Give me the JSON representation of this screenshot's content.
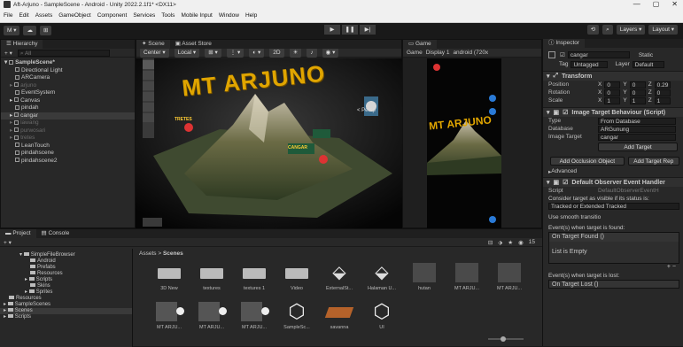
{
  "window": {
    "title": "Aft-Arjuno - SampleScene - Android - Unity 2022.2.1f1* <DX11>",
    "controls": [
      "—",
      "▢",
      "✕"
    ]
  },
  "menu": [
    "File",
    "Edit",
    "Assets",
    "GameObject",
    "Component",
    "Services",
    "Tools",
    "Mobile Input",
    "Window",
    "Help"
  ],
  "toolbar": {
    "account": "M ▾",
    "layers": "Layers",
    "layout": "Layout",
    "play": "▶",
    "pause": "❚❚",
    "step": "▶|"
  },
  "hierarchy": {
    "tab": "Hierarchy",
    "search_placeholder": "All",
    "items": [
      {
        "label": "SampleScene*",
        "state": "root"
      },
      {
        "label": "Directional Light",
        "state": "normal"
      },
      {
        "label": "ARCamera",
        "state": "normal"
      },
      {
        "label": "arjuno",
        "state": "dim"
      },
      {
        "label": "EventSystem",
        "state": "normal"
      },
      {
        "label": "Canvas",
        "state": "normal"
      },
      {
        "label": "pindah",
        "state": "normal"
      },
      {
        "label": "cangar",
        "state": "selected"
      },
      {
        "label": "lawang",
        "state": "dim"
      },
      {
        "label": "purwosari",
        "state": "dim"
      },
      {
        "label": "tretes",
        "state": "dim"
      },
      {
        "label": "LeanTouch",
        "state": "normal"
      },
      {
        "label": "pindahscene",
        "state": "normal"
      },
      {
        "label": "pindahscene2",
        "state": "normal"
      }
    ]
  },
  "scene": {
    "tabs": [
      "Scene",
      "Asset Store"
    ],
    "toolbar": [
      "Center ▾",
      "Local ▾",
      "2D"
    ],
    "persp_label": "< Persp",
    "title_text": "MT ARJUNO",
    "marker_labels": [
      "TRETES",
      "CANGAR"
    ]
  },
  "game": {
    "tab": "Game",
    "toolbar": [
      "Game",
      "Display 1",
      "android (720x"
    ],
    "title_text": "MT ARJUNO"
  },
  "inspector": {
    "tab": "Inspector",
    "object_name": "cangar",
    "static_label": "Static",
    "tag_label": "Tag",
    "tag_value": "Untagged",
    "layer_label": "Layer",
    "layer_value": "Default",
    "transform": {
      "title": "Transform",
      "rows": [
        {
          "label": "Position",
          "x": "0",
          "y": "0",
          "z": "0.29"
        },
        {
          "label": "Rotation",
          "x": "0",
          "y": "0",
          "z": "0"
        },
        {
          "label": "Scale",
          "x": "1",
          "y": "1",
          "z": "1"
        }
      ]
    },
    "image_target": {
      "title": "Image Target Behaviour (Script)",
      "type_label": "Type",
      "type_value": "From Database",
      "database_label": "Database",
      "database_value": "ARGunung",
      "target_label": "Image Target",
      "target_value": "cangar",
      "add_target": "Add Target",
      "add_occlusion": "Add Occlusion Object",
      "add_target_rep": "Add Target Rep",
      "advanced": "Advanced"
    },
    "observer": {
      "title": "Default Observer Event Handler",
      "script_label": "Script",
      "script_value": "DefaultObserverEventH",
      "consider": "Consider target as visible if its status is:",
      "status_value": "Tracked or Extended Tracked",
      "smooth": "Use smooth transitio",
      "found_label": "Event(s) when target is found:",
      "found_event": "On Target Found ()",
      "list_empty": "List is Empty",
      "lost_label": "Event(s) when target is lost:",
      "lost_event": "On Target Lost ()"
    }
  },
  "project": {
    "tabs": [
      "Project",
      "Console"
    ],
    "tree": [
      {
        "label": "SimpleFileBrowser",
        "indent": 2
      },
      {
        "label": "Android",
        "indent": 3
      },
      {
        "label": "Prefabs",
        "indent": 3
      },
      {
        "label": "Resources",
        "indent": 3
      },
      {
        "label": "Scripts",
        "indent": 3
      },
      {
        "label": "Skins",
        "indent": 3
      },
      {
        "label": "Sprites",
        "indent": 3
      },
      {
        "label": "Resources",
        "indent": 1
      },
      {
        "label": "SampleScenes",
        "indent": 1
      },
      {
        "label": "Scenes",
        "indent": 1
      },
      {
        "label": "Scripts",
        "indent": 1
      }
    ],
    "breadcrumb_root": "Assets",
    "breadcrumb_sep": ">",
    "breadcrumb_current": "Scenes",
    "assets_row1": [
      "3D New",
      "textures",
      "textures 1",
      "Video",
      "ExternalSt...",
      "Halaman U...",
      "hutan",
      "MT ARJU...",
      "MT ARJU..."
    ],
    "assets_row2": [
      "MT ARJU...",
      "MT ARJU...",
      "MT ARJU...",
      "SampleSc...",
      "savanna",
      "UI"
    ],
    "count": "15"
  }
}
